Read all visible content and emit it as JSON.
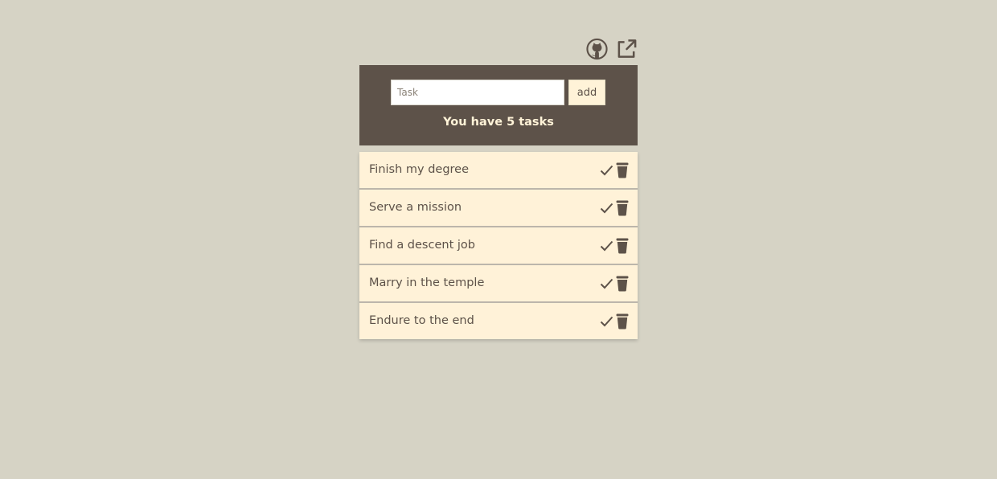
{
  "header_icons": [
    {
      "name": "github-icon"
    },
    {
      "name": "external-link-icon"
    }
  ],
  "form": {
    "input_value": "",
    "input_placeholder": "Task",
    "add_label": "add"
  },
  "summary": "You have 5 tasks",
  "tasks": [
    {
      "label": "Finish my degree"
    },
    {
      "label": "Serve a mission"
    },
    {
      "label": "Find a descent job"
    },
    {
      "label": "Marry in the temple"
    },
    {
      "label": "Endure to the end"
    }
  ],
  "row_icons": [
    "checkmark-icon",
    "trash-icon"
  ],
  "colors": {
    "background": "#d6d3c5",
    "panel": "#5d5249",
    "task_row": "#fff2d8",
    "accent_text": "#fff3d8",
    "text": "#5d5249"
  }
}
